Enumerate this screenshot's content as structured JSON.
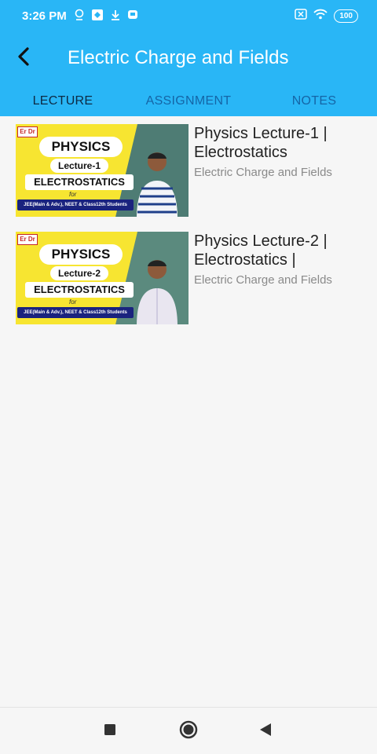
{
  "status_bar": {
    "time": "3:26 PM",
    "icons_left": [
      "location-icon",
      "app-notification-icon",
      "download-icon",
      "chat-icon"
    ],
    "icons_right": [
      "sim-off-icon",
      "wifi-icon"
    ],
    "battery": "100"
  },
  "app_bar": {
    "title": "Electric Charge and Fields",
    "back_icon": "back-arrow-icon"
  },
  "tabs": [
    {
      "label": "LECTURE",
      "active": true
    },
    {
      "label": "ASSIGNMENT",
      "active": false
    },
    {
      "label": "NOTES",
      "active": false
    }
  ],
  "lectures": [
    {
      "title": "Physics Lecture-1 | Electrostatics",
      "subtitle": "Electric Charge and Fields",
      "thumbnail": {
        "logo": "Er Dr",
        "subject": "PHYSICS",
        "lecture": "Lecture-1",
        "topic": "ELECTROSTATICS",
        "for_text": "for",
        "audience": "JEE(Main & Adv.), NEET & Class12th Students"
      }
    },
    {
      "title": "Physics Lecture-2 | Electrostatics |",
      "subtitle": "Electric Charge and Fields",
      "thumbnail": {
        "logo": "Er Dr",
        "subject": "PHYSICS",
        "lecture": "Lecture-2",
        "topic": "ELECTROSTATICS",
        "for_text": "for",
        "audience": "JEE(Main & Adv.), NEET & Class12th Students"
      }
    }
  ],
  "nav_bar": {
    "icons": [
      "recents-square-icon",
      "home-circle-icon",
      "back-triangle-icon"
    ]
  },
  "colors": {
    "primary": "#29b6f6",
    "tab_active_text": "#0d2a44",
    "tab_inactive_text": "#1565a6",
    "background": "#f6f6f6"
  }
}
